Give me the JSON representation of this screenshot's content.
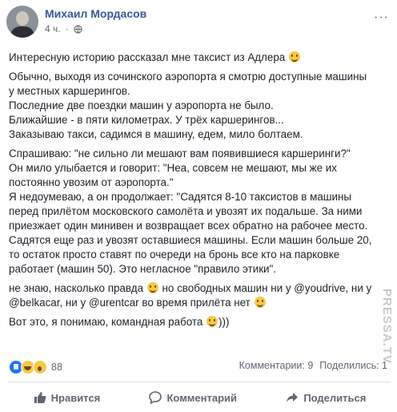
{
  "author": {
    "name": "Михаил Мордасов",
    "time": "4 ч.",
    "more": "···"
  },
  "post": {
    "paragraphs": [
      [
        "Интересную историю рассказал мне таксист из Адлера"
      ],
      [
        "Обычно, выходя из сочинского аэропорта я смотрю доступные машины",
        "у местных каршерингов.",
        "Последние две поездки машин у аэропорта не было.",
        "Ближайшие - в пяти километрах. У трёх каршерингов...",
        "Заказываю такси, садимся в машину, едем, мило болтаем."
      ],
      [
        "Спрашиваю: \"не сильно ли мешают вам появившиеся каршеринги?\"",
        "Он мило улыбается и говорит: \"Неа, совсем не мешают, мы же их",
        "постоянно увозим от аэропорта.\"",
        "Я недоумеваю, а он продолжает: \"Садятся 8-10 таксистов в машины",
        "перед прилётом московского самолёта и увозят их подальше. За ними",
        "приезжает один минивен и возвращает всех обратно на рабочее место.",
        "Садятся еще раз и увозят оставшиеся машины. Если машин больше 20,",
        "то остаток просто ставят по очереди на бронь все кто на парковке",
        "работает (машин 50). Это негласное \"правило этики\"."
      ],
      [
        "не знаю, насколько правда",
        " но свободных машин ни у @youdrive, ни у",
        "@belkacar, ни у @urentcar во время прилёта нет"
      ],
      [
        "Вот это, я понимаю, командная работа",
        ")))"
      ]
    ]
  },
  "stats": {
    "reaction_count": "88",
    "comments": "Комментарии: 9",
    "shares": "Поделились: 1"
  },
  "actions": {
    "like": "Нравится",
    "comment": "Комментарий",
    "share": "Поделиться"
  },
  "watermark": "PRESSA.TV",
  "icons": {
    "globe": "globe-icon",
    "like": "thumb-up-icon",
    "comment": "speech-bubble-icon",
    "share": "share-arrow-icon"
  },
  "colors": {
    "link": "#385898",
    "text": "#1d2129",
    "muted": "#606770",
    "like_blue": "#1877f2"
  }
}
